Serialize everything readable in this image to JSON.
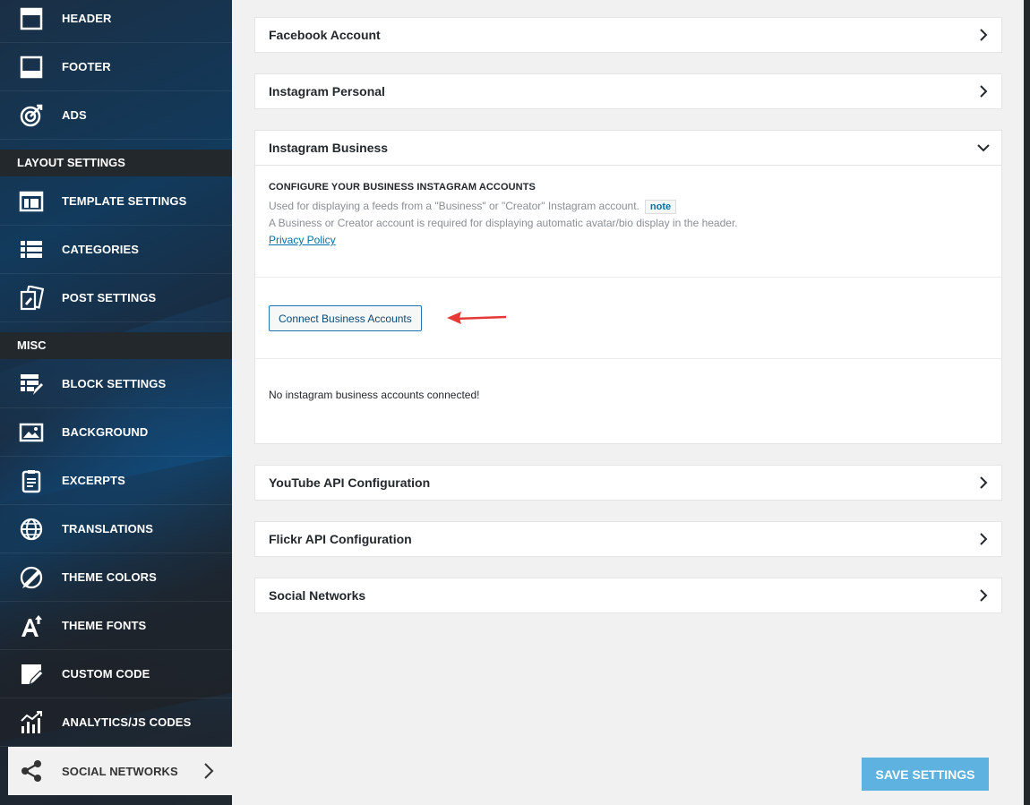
{
  "sidebar": {
    "items": [
      {
        "label": "HEADER",
        "icon": "header-icon"
      },
      {
        "label": "FOOTER",
        "icon": "footer-icon"
      },
      {
        "label": "ADS",
        "icon": "target-icon"
      },
      {
        "section": "LAYOUT SETTINGS"
      },
      {
        "label": "TEMPLATE SETTINGS",
        "icon": "template-icon"
      },
      {
        "label": "CATEGORIES",
        "icon": "list-icon"
      },
      {
        "label": "POST SETTINGS",
        "icon": "post-settings-icon"
      },
      {
        "section": "MISC"
      },
      {
        "label": "BLOCK SETTINGS",
        "icon": "block-settings-icon"
      },
      {
        "label": "BACKGROUND",
        "icon": "image-icon"
      },
      {
        "label": "EXCERPTS",
        "icon": "clipboard-icon"
      },
      {
        "label": "TRANSLATIONS",
        "icon": "globe-icon"
      },
      {
        "label": "THEME COLORS",
        "icon": "brush-icon"
      },
      {
        "label": "THEME FONTS",
        "icon": "font-icon"
      },
      {
        "label": "CUSTOM CODE",
        "icon": "code-edit-icon"
      },
      {
        "label": "ANALYTICS/JS CODES",
        "icon": "analytics-icon"
      },
      {
        "label": "SOCIAL NETWORKS",
        "icon": "share-icon",
        "active": true
      }
    ]
  },
  "panels": {
    "facebook": "Facebook Account",
    "instagram_personal": "Instagram Personal",
    "instagram_business": "Instagram Business",
    "youtube": "YouTube API Configuration",
    "flickr": "Flickr API Configuration",
    "social": "Social Networks"
  },
  "instagram_business": {
    "heading": "CONFIGURE YOUR BUSINESS INSTAGRAM ACCOUNTS",
    "desc1": "Used for displaying a feeds from a \"Business\" or \"Creator\" Instagram account.",
    "note": "note",
    "desc2": "A Business or Creator account is required for displaying automatic avatar/bio display in the header.",
    "privacy": "Privacy Policy",
    "connect_button": "Connect Business Accounts",
    "status": "No instagram business accounts connected!"
  },
  "save_button": "SAVE SETTINGS",
  "colors": {
    "accent": "#5db2e0",
    "link": "#0073aa",
    "arrow": "#e53935"
  }
}
